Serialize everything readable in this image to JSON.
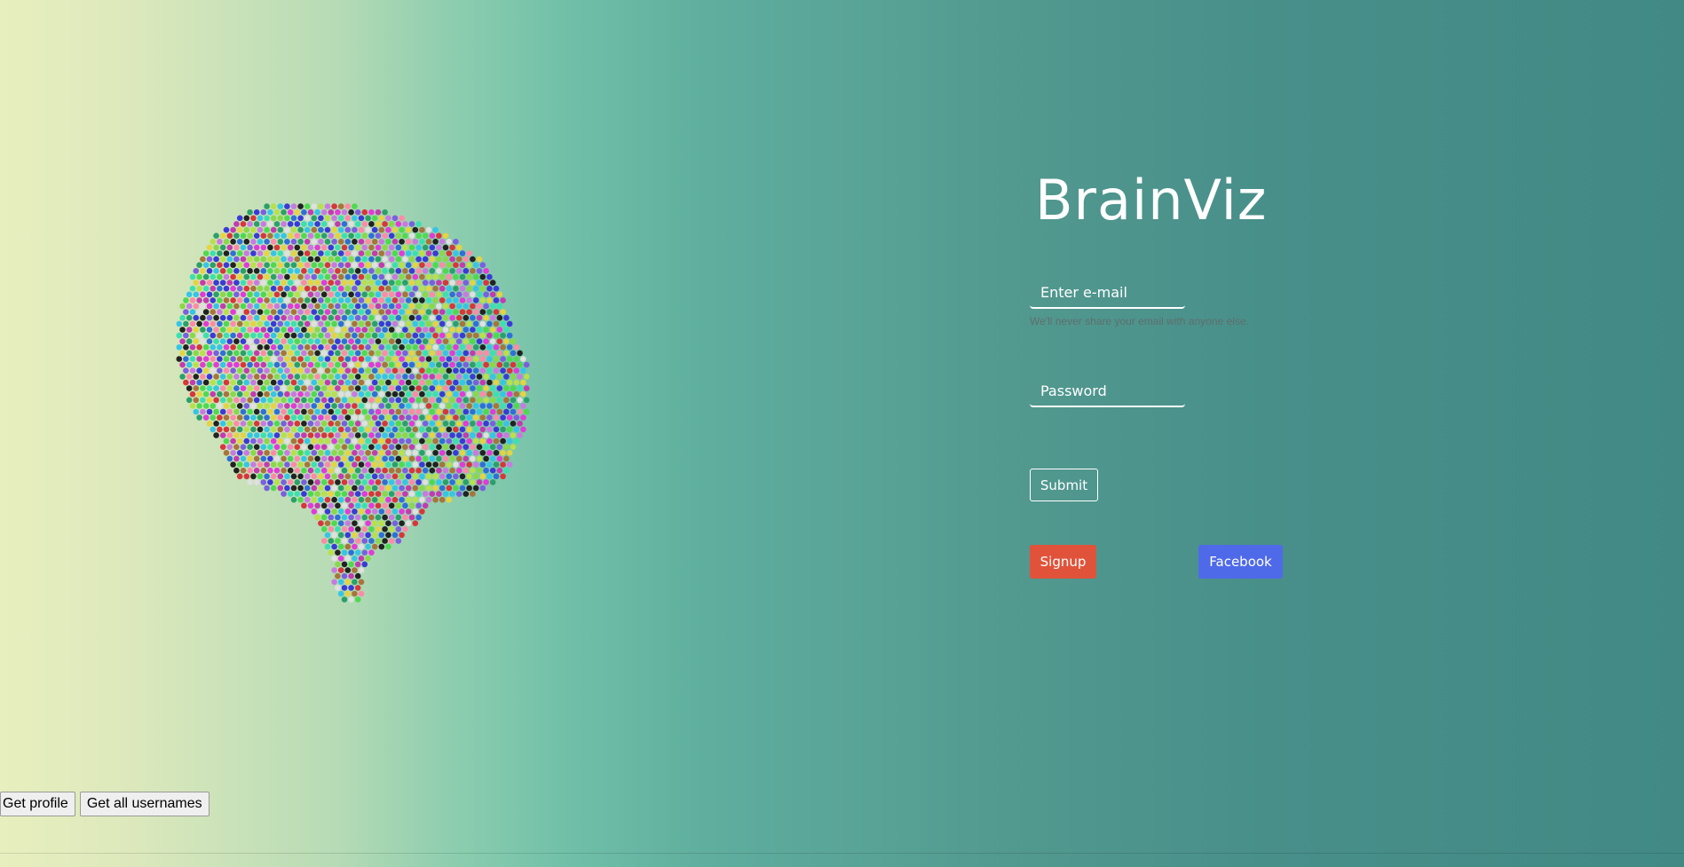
{
  "app": {
    "brand_title": "BrainViz"
  },
  "login_form": {
    "email_placeholder": "Enter e-mail",
    "email_help": "We'll never share your email with anyone else.",
    "password_placeholder": "Password",
    "submit_label": "Submit",
    "signup_label": "Signup",
    "facebook_label": "Facebook"
  },
  "debug_buttons": {
    "get_profile_label": "Get profile",
    "get_all_usernames_label": "Get all usernames"
  },
  "colors": {
    "signup": "#e0533a",
    "facebook": "#4f6ae8",
    "text_on_dark": "#ffffff",
    "dot_palette": [
      "#e5d342",
      "#4fd94f",
      "#35c5e5",
      "#e23bd8",
      "#3a3ad8",
      "#d8363a",
      "#8ad84a",
      "#c97ae0",
      "#2aa06a",
      "#222222",
      "#b8e04a",
      "#ff8aa8",
      "#7a5fe0",
      "#3ce0b0",
      "#a8743a",
      "#e0e0e0",
      "#2f6fd8",
      "#c43bb0"
    ]
  },
  "illustration": {
    "name": "brain-dot-illustration"
  }
}
